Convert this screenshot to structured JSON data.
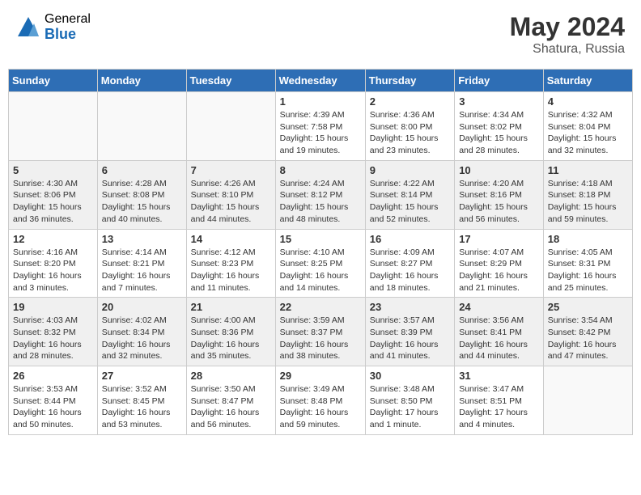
{
  "header": {
    "logo_general": "General",
    "logo_blue": "Blue",
    "month_year": "May 2024",
    "location": "Shatura, Russia"
  },
  "weekdays": [
    "Sunday",
    "Monday",
    "Tuesday",
    "Wednesday",
    "Thursday",
    "Friday",
    "Saturday"
  ],
  "weeks": [
    [
      {
        "day": "",
        "info": ""
      },
      {
        "day": "",
        "info": ""
      },
      {
        "day": "",
        "info": ""
      },
      {
        "day": "1",
        "info": "Sunrise: 4:39 AM\nSunset: 7:58 PM\nDaylight: 15 hours\nand 19 minutes."
      },
      {
        "day": "2",
        "info": "Sunrise: 4:36 AM\nSunset: 8:00 PM\nDaylight: 15 hours\nand 23 minutes."
      },
      {
        "day": "3",
        "info": "Sunrise: 4:34 AM\nSunset: 8:02 PM\nDaylight: 15 hours\nand 28 minutes."
      },
      {
        "day": "4",
        "info": "Sunrise: 4:32 AM\nSunset: 8:04 PM\nDaylight: 15 hours\nand 32 minutes."
      }
    ],
    [
      {
        "day": "5",
        "info": "Sunrise: 4:30 AM\nSunset: 8:06 PM\nDaylight: 15 hours\nand 36 minutes."
      },
      {
        "day": "6",
        "info": "Sunrise: 4:28 AM\nSunset: 8:08 PM\nDaylight: 15 hours\nand 40 minutes."
      },
      {
        "day": "7",
        "info": "Sunrise: 4:26 AM\nSunset: 8:10 PM\nDaylight: 15 hours\nand 44 minutes."
      },
      {
        "day": "8",
        "info": "Sunrise: 4:24 AM\nSunset: 8:12 PM\nDaylight: 15 hours\nand 48 minutes."
      },
      {
        "day": "9",
        "info": "Sunrise: 4:22 AM\nSunset: 8:14 PM\nDaylight: 15 hours\nand 52 minutes."
      },
      {
        "day": "10",
        "info": "Sunrise: 4:20 AM\nSunset: 8:16 PM\nDaylight: 15 hours\nand 56 minutes."
      },
      {
        "day": "11",
        "info": "Sunrise: 4:18 AM\nSunset: 8:18 PM\nDaylight: 15 hours\nand 59 minutes."
      }
    ],
    [
      {
        "day": "12",
        "info": "Sunrise: 4:16 AM\nSunset: 8:20 PM\nDaylight: 16 hours\nand 3 minutes."
      },
      {
        "day": "13",
        "info": "Sunrise: 4:14 AM\nSunset: 8:21 PM\nDaylight: 16 hours\nand 7 minutes."
      },
      {
        "day": "14",
        "info": "Sunrise: 4:12 AM\nSunset: 8:23 PM\nDaylight: 16 hours\nand 11 minutes."
      },
      {
        "day": "15",
        "info": "Sunrise: 4:10 AM\nSunset: 8:25 PM\nDaylight: 16 hours\nand 14 minutes."
      },
      {
        "day": "16",
        "info": "Sunrise: 4:09 AM\nSunset: 8:27 PM\nDaylight: 16 hours\nand 18 minutes."
      },
      {
        "day": "17",
        "info": "Sunrise: 4:07 AM\nSunset: 8:29 PM\nDaylight: 16 hours\nand 21 minutes."
      },
      {
        "day": "18",
        "info": "Sunrise: 4:05 AM\nSunset: 8:31 PM\nDaylight: 16 hours\nand 25 minutes."
      }
    ],
    [
      {
        "day": "19",
        "info": "Sunrise: 4:03 AM\nSunset: 8:32 PM\nDaylight: 16 hours\nand 28 minutes."
      },
      {
        "day": "20",
        "info": "Sunrise: 4:02 AM\nSunset: 8:34 PM\nDaylight: 16 hours\nand 32 minutes."
      },
      {
        "day": "21",
        "info": "Sunrise: 4:00 AM\nSunset: 8:36 PM\nDaylight: 16 hours\nand 35 minutes."
      },
      {
        "day": "22",
        "info": "Sunrise: 3:59 AM\nSunset: 8:37 PM\nDaylight: 16 hours\nand 38 minutes."
      },
      {
        "day": "23",
        "info": "Sunrise: 3:57 AM\nSunset: 8:39 PM\nDaylight: 16 hours\nand 41 minutes."
      },
      {
        "day": "24",
        "info": "Sunrise: 3:56 AM\nSunset: 8:41 PM\nDaylight: 16 hours\nand 44 minutes."
      },
      {
        "day": "25",
        "info": "Sunrise: 3:54 AM\nSunset: 8:42 PM\nDaylight: 16 hours\nand 47 minutes."
      }
    ],
    [
      {
        "day": "26",
        "info": "Sunrise: 3:53 AM\nSunset: 8:44 PM\nDaylight: 16 hours\nand 50 minutes."
      },
      {
        "day": "27",
        "info": "Sunrise: 3:52 AM\nSunset: 8:45 PM\nDaylight: 16 hours\nand 53 minutes."
      },
      {
        "day": "28",
        "info": "Sunrise: 3:50 AM\nSunset: 8:47 PM\nDaylight: 16 hours\nand 56 minutes."
      },
      {
        "day": "29",
        "info": "Sunrise: 3:49 AM\nSunset: 8:48 PM\nDaylight: 16 hours\nand 59 minutes."
      },
      {
        "day": "30",
        "info": "Sunrise: 3:48 AM\nSunset: 8:50 PM\nDaylight: 17 hours\nand 1 minute."
      },
      {
        "day": "31",
        "info": "Sunrise: 3:47 AM\nSunset: 8:51 PM\nDaylight: 17 hours\nand 4 minutes."
      },
      {
        "day": "",
        "info": ""
      }
    ]
  ]
}
